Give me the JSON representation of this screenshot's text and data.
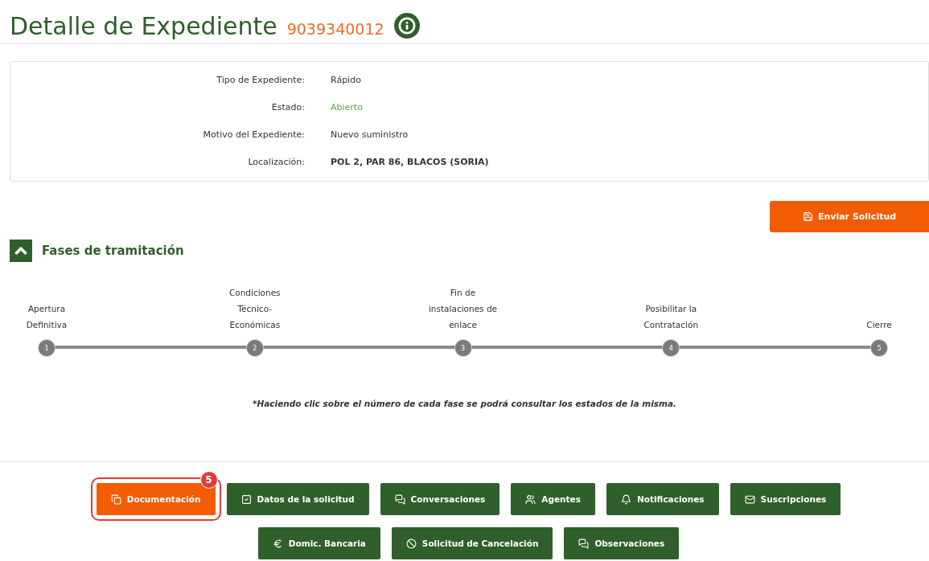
{
  "header": {
    "title": "Detalle de Expediente",
    "number": "9039340012"
  },
  "details": [
    {
      "label": "Tipo de Expediente:",
      "value": "Rápido",
      "kind": "plain"
    },
    {
      "label": "Estado:",
      "value": "Abierto",
      "kind": "status"
    },
    {
      "label": "Motivo del Expediente:",
      "value": "Nuevo suministro",
      "kind": "plain"
    },
    {
      "label": "Localización:",
      "value": "POL 2, PAR 86, BLACOS (SORIA)",
      "kind": "strong"
    }
  ],
  "send_button": {
    "label": "Enviar Solicitud"
  },
  "phases": {
    "title": "Fases de tramitación",
    "expanded": true,
    "steps": [
      {
        "label": "Apertura Definitiva",
        "number": "1"
      },
      {
        "label": "Condiciones Técnico-Económicas",
        "number": "2"
      },
      {
        "label": "Fin de instalaciones de enlace",
        "number": "3"
      },
      {
        "label": "Posibilitar la Contratación",
        "number": "4"
      },
      {
        "label": "Cierre",
        "number": "5"
      }
    ],
    "note": "*Haciendo clic sobre el número de cada fase se podrá consultar los estados de la misma."
  },
  "actions": [
    {
      "label": "Documentación",
      "kind": "docs",
      "selected": true,
      "badge": "5"
    },
    {
      "label": "Datos de la solicitud",
      "kind": "check",
      "selected": false
    },
    {
      "label": "Conversaciones",
      "kind": "chat",
      "selected": false
    },
    {
      "label": "Agentes",
      "kind": "users",
      "selected": false
    },
    {
      "label": "Notificaciones",
      "kind": "bell",
      "selected": false
    },
    {
      "label": "Suscripciones",
      "kind": "mail",
      "selected": false
    },
    {
      "label": "Domic. Bancaria",
      "kind": "euro",
      "selected": false
    },
    {
      "label": "Solicitud de Cancelación",
      "kind": "ban",
      "selected": false
    },
    {
      "label": "Observaciones",
      "kind": "chat",
      "selected": false
    }
  ]
}
